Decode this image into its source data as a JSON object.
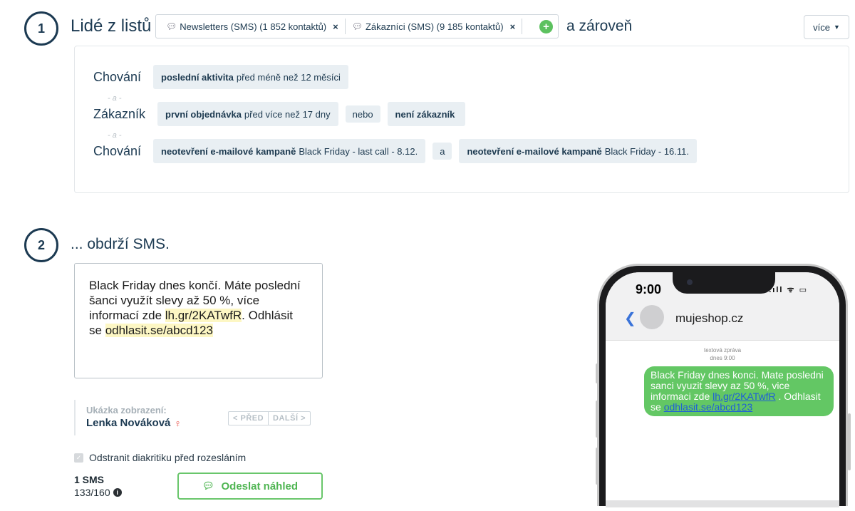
{
  "step1": {
    "number": "1",
    "title": "Lidé z listů",
    "lists": [
      {
        "label": "Newsletters (SMS) (1 852 kontaktů)"
      },
      {
        "label": "Zákazníci (SMS) (9 185 kontaktů)"
      }
    ],
    "remove_label": "×",
    "add_label": "+",
    "and_text": "a zároveň",
    "more_label": "více",
    "conditions": {
      "row1": {
        "label": "Chování",
        "chip_bold": "poslední aktivita",
        "chip_text": "před méně než 12 měsíci"
      },
      "joiner1": "- a -",
      "row2": {
        "label": "Zákazník",
        "chip1_bold": "první objednávka",
        "chip1_text": "před více než 17 dny",
        "op": "nebo",
        "chip2_bold": "není zákazník"
      },
      "joiner2": "- a -",
      "row3": {
        "label": "Chování",
        "chip1_bold": "neotevření e-mailové kampaně",
        "chip1_text": "Black Friday - last call - 8.12.",
        "op": "a",
        "chip2_bold": "neotevření e-mailové kampaně",
        "chip2_text": "Black Friday - 16.11."
      }
    }
  },
  "step2": {
    "number": "2",
    "title": "... obdrží SMS.",
    "sms_text": {
      "part1": "Black Friday dnes končí. Máte poslední šanci využít slevy až 50 %, více informací zde ",
      "link1": "lh.gr/2KATwfR",
      "part2": ". Odhlásit se ",
      "link2": "odhlasit.se/abcd123"
    },
    "preview": {
      "label": "Ukázka zobrazení:",
      "name": "Lenka Nováková",
      "prev": "< PŘED",
      "next": "DALŠÍ >"
    },
    "remove_diacritics": "Odstranit diakritiku před rozesláním",
    "sms_count": "1 SMS",
    "char_count": "133/160",
    "send_preview": "Odeslat náhled"
  },
  "phone": {
    "time": "9:00",
    "status": ".ıll ᯤ ▭",
    "contact": "mujeshop.cz",
    "meta_type": "textová zpráva",
    "meta_time": "dnes 9:00",
    "message": {
      "part1": "Black Friday dnes konci. Mate posledni sanci vyuzit slevy az 50 %, vice informaci zde ",
      "link1": "lh.gr/2KATwfR",
      "part2": " . Odhlasit se ",
      "link2": "odhlasit.se/abcd123"
    }
  },
  "colors": {
    "primary_dark": "#1c3a52",
    "chip_bg": "#e9eff3",
    "accent_green": "#5cc15f",
    "highlight": "#fdf7c4",
    "imessage_green": "#63c764"
  }
}
